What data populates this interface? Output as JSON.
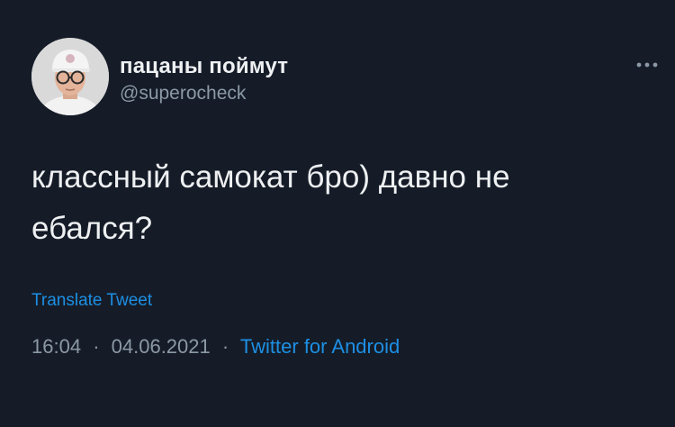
{
  "tweet": {
    "author": {
      "display_name": "пацаны поймут",
      "handle": "@superocheck",
      "avatar_icon": "user-avatar-photo"
    },
    "more_icon": "more-horizontal-icon",
    "text_line1": "классный самокат бро) давно не",
    "text_line2": "ебался?",
    "translate_label": "Translate Tweet",
    "time": "16:04",
    "separator": "·",
    "date": "04.06.2021",
    "source": "Twitter for Android"
  },
  "colors": {
    "background": "#151c28",
    "text": "#eef0f2",
    "secondary_text": "#8b98a5",
    "accent": "#1d8fe3"
  }
}
